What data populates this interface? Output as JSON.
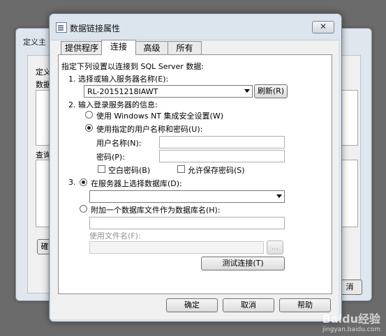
{
  "background_window": {
    "title": "定义主",
    "label_1": "定义",
    "label_2": "数据",
    "label_3": "查询",
    "button_right": "消",
    "button_left": "確"
  },
  "dialog": {
    "title": "数据链接属性",
    "close_glyph": "✕",
    "tabs": [
      {
        "label": "提供程序"
      },
      {
        "label": "连接"
      },
      {
        "label": "高级"
      },
      {
        "label": "所有"
      }
    ],
    "intro": "指定下列设置以连接到 SQL Server 数据:",
    "step1": {
      "label": "1. 选择或输入服务器名称(E):",
      "server_value": "RL-20151218IAWT",
      "refresh_label": "刷新(R)"
    },
    "step2": {
      "label": "2. 输入登录服务器的信息:",
      "radio_windows": "使用 Windows NT 集成安全设置(W)",
      "radio_specific": "使用指定的用户名称和密码(U):",
      "username_label": "用户名称(N):",
      "password_label": "密码(P):",
      "blank_password": "空白密码(B)",
      "allow_save": "允许保存密码(S)"
    },
    "step3": {
      "prefix": "3.",
      "radio_select_db": "在服务器上选择数据库(D):",
      "radio_attach": "附加一个数据库文件作为数据库名(H):",
      "use_filename": "使用文件名(F):",
      "browse_label": "..."
    },
    "test_button": "测试连接(T)",
    "ok_button": "确定",
    "cancel_button": "取消",
    "help_button": "帮助"
  },
  "watermark": {
    "brand": "Baidu经验",
    "url": "jingyan.baidu.com"
  }
}
